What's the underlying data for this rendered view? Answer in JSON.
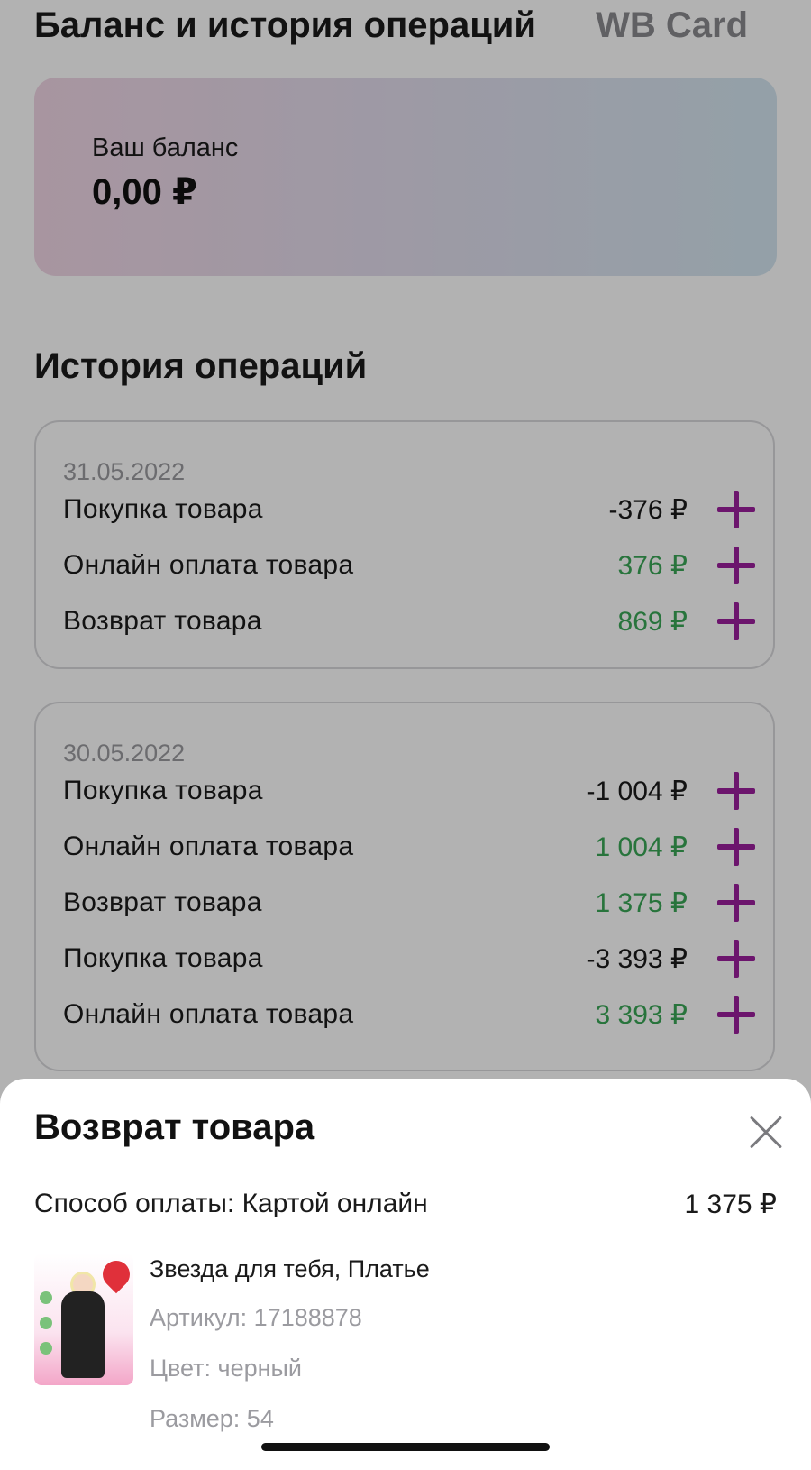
{
  "header": {
    "title": "Баланс и история операций",
    "second_tab": "WB Card"
  },
  "balance": {
    "label": "Ваш баланс",
    "value": "0,00 ₽"
  },
  "history": {
    "title": "История операций",
    "groups": [
      {
        "date": "31.05.2022",
        "operations": [
          {
            "label": "Покупка товара",
            "amount": "-376 ₽",
            "type": "negative"
          },
          {
            "label": "Онлайн оплата товара",
            "amount": "376 ₽",
            "type": "positive"
          },
          {
            "label": "Возврат товара",
            "amount": "869 ₽",
            "type": "positive"
          }
        ]
      },
      {
        "date": "30.05.2022",
        "operations": [
          {
            "label": "Покупка товара",
            "amount": "-1 004 ₽",
            "type": "negative"
          },
          {
            "label": "Онлайн оплата товара",
            "amount": "1 004 ₽",
            "type": "positive"
          },
          {
            "label": "Возврат товара",
            "amount": "1 375 ₽",
            "type": "positive"
          },
          {
            "label": "Покупка товара",
            "amount": "-3 393 ₽",
            "type": "negative"
          },
          {
            "label": "Онлайн оплата товара",
            "amount": "3 393 ₽",
            "type": "positive"
          }
        ]
      }
    ]
  },
  "sheet": {
    "title": "Возврат товара",
    "payment_method": "Способ оплаты: Картой онлайн",
    "amount": "1 375 ₽",
    "product": {
      "name": "Звезда для тебя, Платье",
      "article": "Артикул: 17188878",
      "color": "Цвет: черный",
      "size": "Размер: 54"
    }
  },
  "colors": {
    "accent_plus": "#9b1f9c",
    "positive_amount": "#3aa657",
    "negative_amount": "#1a1a1a"
  },
  "icons": {
    "expand": "plus-icon",
    "close": "close-icon"
  }
}
